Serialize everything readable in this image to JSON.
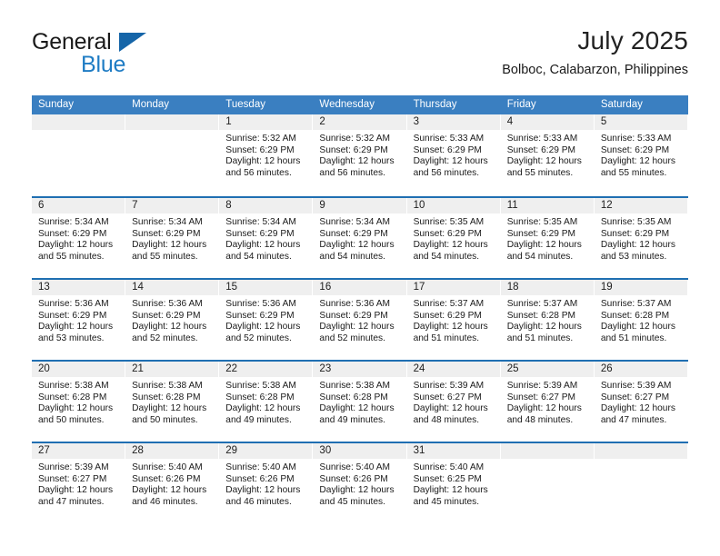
{
  "brand": {
    "name_part1": "General",
    "name_part2": "Blue",
    "triangle_color": "#1565a8",
    "blue_color": "#1f7cc4"
  },
  "header": {
    "month_title": "July 2025",
    "location": "Bolboc, Calabarzon, Philippines"
  },
  "theme": {
    "header_blue": "#3a7fc1",
    "row_border_blue": "#1f6fb2",
    "day_band_gray": "#efefef",
    "text_color": "#1a1a1a"
  },
  "calendar": {
    "day_headers": [
      "Sunday",
      "Monday",
      "Tuesday",
      "Wednesday",
      "Thursday",
      "Friday",
      "Saturday"
    ],
    "weeks": [
      [
        {
          "day": "",
          "sunrise": "",
          "sunset": "",
          "daylight1": "",
          "daylight2": ""
        },
        {
          "day": "",
          "sunrise": "",
          "sunset": "",
          "daylight1": "",
          "daylight2": ""
        },
        {
          "day": "1",
          "sunrise": "Sunrise: 5:32 AM",
          "sunset": "Sunset: 6:29 PM",
          "daylight1": "Daylight: 12 hours",
          "daylight2": "and 56 minutes."
        },
        {
          "day": "2",
          "sunrise": "Sunrise: 5:32 AM",
          "sunset": "Sunset: 6:29 PM",
          "daylight1": "Daylight: 12 hours",
          "daylight2": "and 56 minutes."
        },
        {
          "day": "3",
          "sunrise": "Sunrise: 5:33 AM",
          "sunset": "Sunset: 6:29 PM",
          "daylight1": "Daylight: 12 hours",
          "daylight2": "and 56 minutes."
        },
        {
          "day": "4",
          "sunrise": "Sunrise: 5:33 AM",
          "sunset": "Sunset: 6:29 PM",
          "daylight1": "Daylight: 12 hours",
          "daylight2": "and 55 minutes."
        },
        {
          "day": "5",
          "sunrise": "Sunrise: 5:33 AM",
          "sunset": "Sunset: 6:29 PM",
          "daylight1": "Daylight: 12 hours",
          "daylight2": "and 55 minutes."
        }
      ],
      [
        {
          "day": "6",
          "sunrise": "Sunrise: 5:34 AM",
          "sunset": "Sunset: 6:29 PM",
          "daylight1": "Daylight: 12 hours",
          "daylight2": "and 55 minutes."
        },
        {
          "day": "7",
          "sunrise": "Sunrise: 5:34 AM",
          "sunset": "Sunset: 6:29 PM",
          "daylight1": "Daylight: 12 hours",
          "daylight2": "and 55 minutes."
        },
        {
          "day": "8",
          "sunrise": "Sunrise: 5:34 AM",
          "sunset": "Sunset: 6:29 PM",
          "daylight1": "Daylight: 12 hours",
          "daylight2": "and 54 minutes."
        },
        {
          "day": "9",
          "sunrise": "Sunrise: 5:34 AM",
          "sunset": "Sunset: 6:29 PM",
          "daylight1": "Daylight: 12 hours",
          "daylight2": "and 54 minutes."
        },
        {
          "day": "10",
          "sunrise": "Sunrise: 5:35 AM",
          "sunset": "Sunset: 6:29 PM",
          "daylight1": "Daylight: 12 hours",
          "daylight2": "and 54 minutes."
        },
        {
          "day": "11",
          "sunrise": "Sunrise: 5:35 AM",
          "sunset": "Sunset: 6:29 PM",
          "daylight1": "Daylight: 12 hours",
          "daylight2": "and 54 minutes."
        },
        {
          "day": "12",
          "sunrise": "Sunrise: 5:35 AM",
          "sunset": "Sunset: 6:29 PM",
          "daylight1": "Daylight: 12 hours",
          "daylight2": "and 53 minutes."
        }
      ],
      [
        {
          "day": "13",
          "sunrise": "Sunrise: 5:36 AM",
          "sunset": "Sunset: 6:29 PM",
          "daylight1": "Daylight: 12 hours",
          "daylight2": "and 53 minutes."
        },
        {
          "day": "14",
          "sunrise": "Sunrise: 5:36 AM",
          "sunset": "Sunset: 6:29 PM",
          "daylight1": "Daylight: 12 hours",
          "daylight2": "and 52 minutes."
        },
        {
          "day": "15",
          "sunrise": "Sunrise: 5:36 AM",
          "sunset": "Sunset: 6:29 PM",
          "daylight1": "Daylight: 12 hours",
          "daylight2": "and 52 minutes."
        },
        {
          "day": "16",
          "sunrise": "Sunrise: 5:36 AM",
          "sunset": "Sunset: 6:29 PM",
          "daylight1": "Daylight: 12 hours",
          "daylight2": "and 52 minutes."
        },
        {
          "day": "17",
          "sunrise": "Sunrise: 5:37 AM",
          "sunset": "Sunset: 6:29 PM",
          "daylight1": "Daylight: 12 hours",
          "daylight2": "and 51 minutes."
        },
        {
          "day": "18",
          "sunrise": "Sunrise: 5:37 AM",
          "sunset": "Sunset: 6:28 PM",
          "daylight1": "Daylight: 12 hours",
          "daylight2": "and 51 minutes."
        },
        {
          "day": "19",
          "sunrise": "Sunrise: 5:37 AM",
          "sunset": "Sunset: 6:28 PM",
          "daylight1": "Daylight: 12 hours",
          "daylight2": "and 51 minutes."
        }
      ],
      [
        {
          "day": "20",
          "sunrise": "Sunrise: 5:38 AM",
          "sunset": "Sunset: 6:28 PM",
          "daylight1": "Daylight: 12 hours",
          "daylight2": "and 50 minutes."
        },
        {
          "day": "21",
          "sunrise": "Sunrise: 5:38 AM",
          "sunset": "Sunset: 6:28 PM",
          "daylight1": "Daylight: 12 hours",
          "daylight2": "and 50 minutes."
        },
        {
          "day": "22",
          "sunrise": "Sunrise: 5:38 AM",
          "sunset": "Sunset: 6:28 PM",
          "daylight1": "Daylight: 12 hours",
          "daylight2": "and 49 minutes."
        },
        {
          "day": "23",
          "sunrise": "Sunrise: 5:38 AM",
          "sunset": "Sunset: 6:28 PM",
          "daylight1": "Daylight: 12 hours",
          "daylight2": "and 49 minutes."
        },
        {
          "day": "24",
          "sunrise": "Sunrise: 5:39 AM",
          "sunset": "Sunset: 6:27 PM",
          "daylight1": "Daylight: 12 hours",
          "daylight2": "and 48 minutes."
        },
        {
          "day": "25",
          "sunrise": "Sunrise: 5:39 AM",
          "sunset": "Sunset: 6:27 PM",
          "daylight1": "Daylight: 12 hours",
          "daylight2": "and 48 minutes."
        },
        {
          "day": "26",
          "sunrise": "Sunrise: 5:39 AM",
          "sunset": "Sunset: 6:27 PM",
          "daylight1": "Daylight: 12 hours",
          "daylight2": "and 47 minutes."
        }
      ],
      [
        {
          "day": "27",
          "sunrise": "Sunrise: 5:39 AM",
          "sunset": "Sunset: 6:27 PM",
          "daylight1": "Daylight: 12 hours",
          "daylight2": "and 47 minutes."
        },
        {
          "day": "28",
          "sunrise": "Sunrise: 5:40 AM",
          "sunset": "Sunset: 6:26 PM",
          "daylight1": "Daylight: 12 hours",
          "daylight2": "and 46 minutes."
        },
        {
          "day": "29",
          "sunrise": "Sunrise: 5:40 AM",
          "sunset": "Sunset: 6:26 PM",
          "daylight1": "Daylight: 12 hours",
          "daylight2": "and 46 minutes."
        },
        {
          "day": "30",
          "sunrise": "Sunrise: 5:40 AM",
          "sunset": "Sunset: 6:26 PM",
          "daylight1": "Daylight: 12 hours",
          "daylight2": "and 45 minutes."
        },
        {
          "day": "31",
          "sunrise": "Sunrise: 5:40 AM",
          "sunset": "Sunset: 6:25 PM",
          "daylight1": "Daylight: 12 hours",
          "daylight2": "and 45 minutes."
        },
        {
          "day": "",
          "sunrise": "",
          "sunset": "",
          "daylight1": "",
          "daylight2": ""
        },
        {
          "day": "",
          "sunrise": "",
          "sunset": "",
          "daylight1": "",
          "daylight2": ""
        }
      ]
    ]
  }
}
